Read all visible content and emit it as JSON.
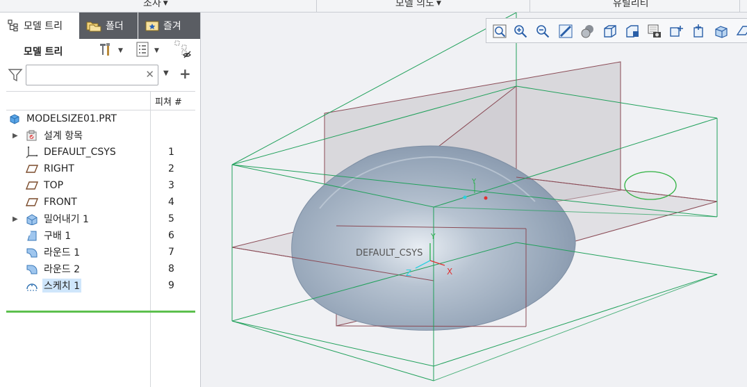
{
  "ribbon": {
    "groups": [
      {
        "label": "조사",
        "has_dropdown": true
      },
      {
        "label": "모델 의도",
        "has_dropdown": true
      },
      {
        "label": "유틸리티",
        "has_dropdown": false
      }
    ]
  },
  "tabs": [
    {
      "label": "모델 트리",
      "icon": "model-tree-icon",
      "active": true
    },
    {
      "label": "폴더",
      "icon": "folder-icon",
      "active": false
    },
    {
      "label": "즐겨",
      "icon": "favorites-icon",
      "active": false
    }
  ],
  "model_tree": {
    "title": "모델 트리",
    "search": {
      "value": "",
      "placeholder": ""
    },
    "columns": {
      "feature_number": "피쳐 #"
    },
    "items": [
      {
        "label": "MODELSIZE01.PRT",
        "number": "",
        "icon": "part-icon",
        "expandable": false,
        "level": 0
      },
      {
        "label": "설계 항목",
        "number": "",
        "icon": "design-items-icon",
        "expandable": true,
        "level": 1
      },
      {
        "label": "DEFAULT_CSYS",
        "number": "1",
        "icon": "csys-icon",
        "expandable": false,
        "level": 1
      },
      {
        "label": "RIGHT",
        "number": "2",
        "icon": "datum-plane-icon",
        "expandable": false,
        "level": 1
      },
      {
        "label": "TOP",
        "number": "3",
        "icon": "datum-plane-icon",
        "expandable": false,
        "level": 1
      },
      {
        "label": "FRONT",
        "number": "4",
        "icon": "datum-plane-icon",
        "expandable": false,
        "level": 1
      },
      {
        "label": "밀어내기 1",
        "number": "5",
        "icon": "extrude-icon",
        "expandable": true,
        "level": 1
      },
      {
        "label": "구배 1",
        "number": "6",
        "icon": "draft-icon",
        "expandable": false,
        "level": 1
      },
      {
        "label": "라운드 1",
        "number": "7",
        "icon": "round-icon",
        "expandable": false,
        "level": 1
      },
      {
        "label": "라운드 2",
        "number": "8",
        "icon": "round-icon",
        "expandable": false,
        "level": 1
      },
      {
        "label": "스케치 1",
        "number": "9",
        "icon": "sketch-icon",
        "expandable": false,
        "level": 1,
        "selected": true
      }
    ]
  },
  "view_toolbar": {
    "buttons": [
      "refit-icon",
      "zoom-in-icon",
      "zoom-out-icon",
      "repaint-icon",
      "display-style-icon",
      "saved-orientations-icon",
      "view-manager-icon",
      "perspective-icon",
      "datum-display-icon",
      "annotation-display-icon",
      "spin-center-icon",
      "section-icon"
    ]
  },
  "viewport": {
    "csys_label": "DEFAULT_CSYS",
    "axis_labels": {
      "x": "X",
      "y": "Y",
      "z": "Z"
    },
    "colors": {
      "background": "#f0f1f4",
      "datum_frame": "#1fa05a",
      "plane_edges": "#8a4a55",
      "surface": "#a9b6c6"
    }
  },
  "colors": {
    "insert_indicator": "#5cc04e",
    "selection": "#cfe6fb",
    "inactive_tab": "#5a5d63"
  }
}
